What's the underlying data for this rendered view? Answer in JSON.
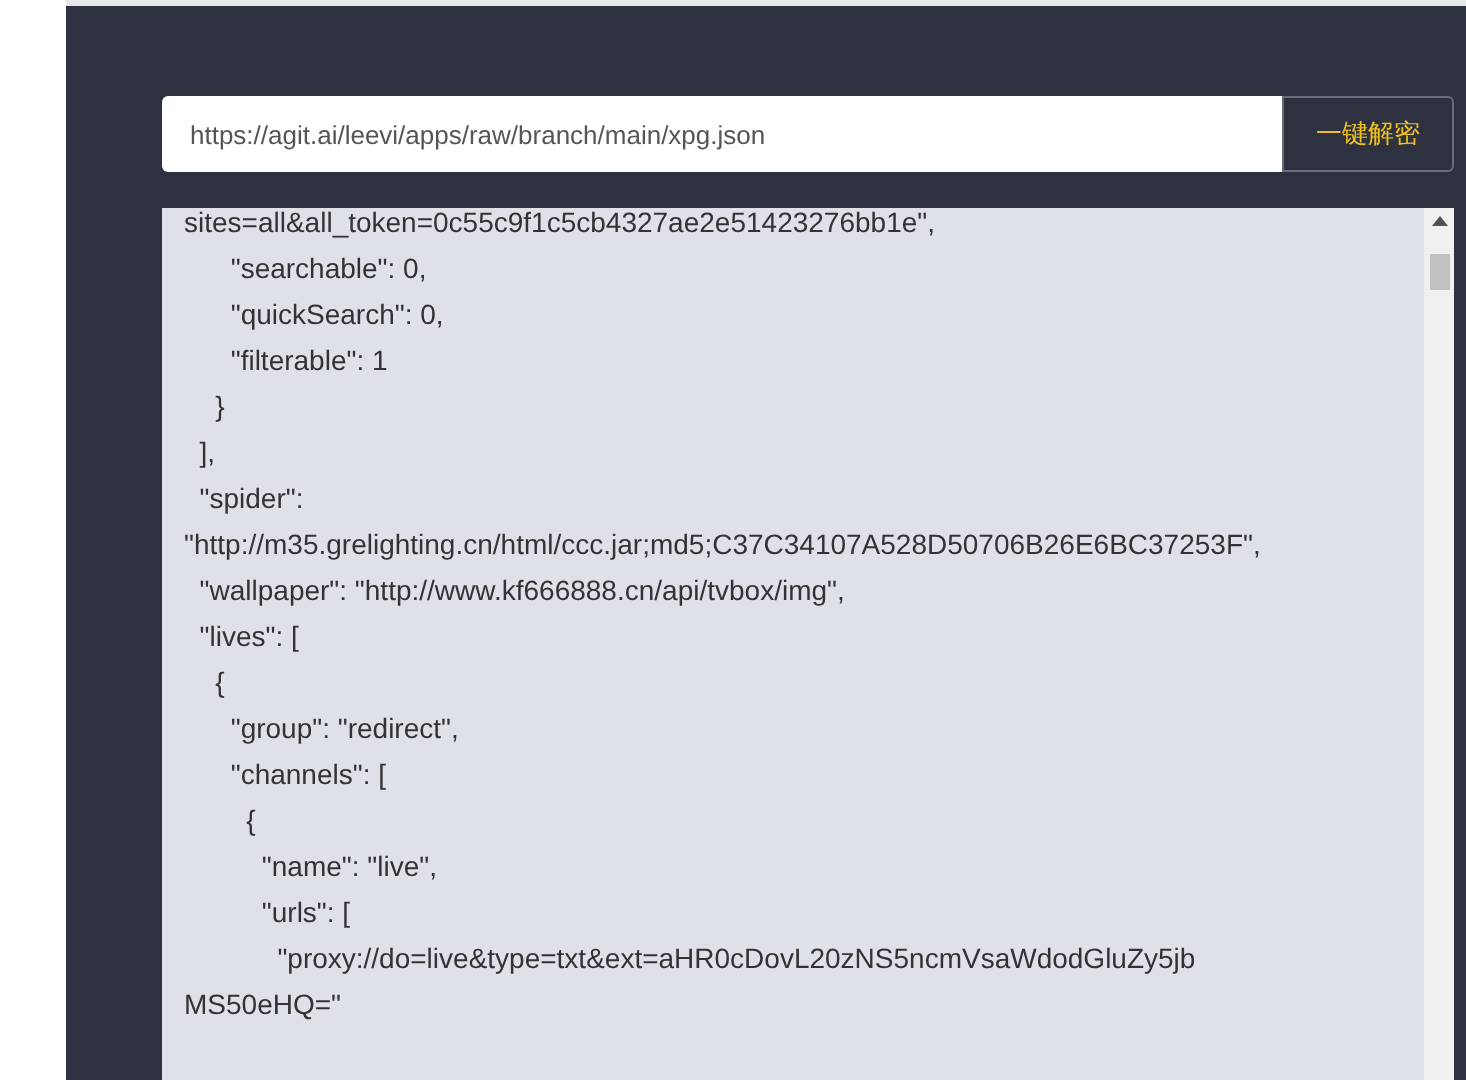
{
  "url_field": {
    "value": "https://agit.ai/leevi/apps/raw/branch/main/xpg.json"
  },
  "decode_button": {
    "label": "一键解密"
  },
  "output": {
    "lines": [
      {
        "text": "sites=all&all_token=0c55c9f1c5cb4327ae2e51423276bb1e\","
      },
      {
        "text": "      \"searchable\": 0,"
      },
      {
        "text": "      \"quickSearch\": 0,"
      },
      {
        "text": "      \"filterable\": 1"
      },
      {
        "text": "    }"
      },
      {
        "text": "  ],"
      },
      {
        "text": "  \"spider\":"
      },
      {
        "text": "\"http://m35.grelighting.cn/html/ccc.jar;md5;C37C34107A528D50706B26E6BC37253F\","
      },
      {
        "text": "  \"wallpaper\": \"http://www.kf666888.cn/api/tvbox/img\","
      },
      {
        "text": "  \"lives\": ["
      },
      {
        "text": "    {"
      },
      {
        "text": "      \"group\": \"redirect\","
      },
      {
        "text": "      \"channels\": ["
      },
      {
        "text": "        {"
      },
      {
        "text": "          \"name\": \"live\","
      },
      {
        "text": "          \"urls\": ["
      },
      {
        "text": "            \"proxy://do=live&type=txt&ext=aHR0cDovL20zNS5ncmVsaWdodGluZy5jb"
      },
      {
        "text": "MS50eHQ=\""
      }
    ]
  }
}
